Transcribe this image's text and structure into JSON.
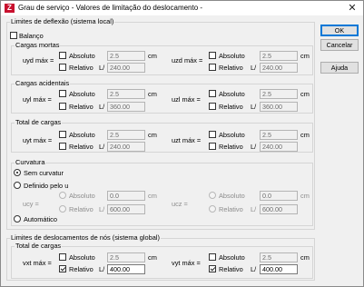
{
  "window": {
    "title": "Grau de serviço - Valores de limitação do deslocamento -",
    "close_glyph": "✕",
    "icon_glyph": "Z"
  },
  "buttons": {
    "ok": "OK",
    "cancel": "Cancelar",
    "help": "Ajuda"
  },
  "deflection": {
    "group_title": "Limites de deflexão (sistema local)",
    "balanco_label": "Balanço",
    "sections": [
      {
        "title": "Cargas mortas",
        "left": {
          "label": "uyd máx =",
          "absoluto_label": "Absoluto",
          "absoluto_value": "2.5",
          "unit": "cm",
          "relativo_label": "Relativo",
          "l_prefix": "L/",
          "relativo_value": "240.00"
        },
        "right": {
          "label": "uzd máx =",
          "absoluto_label": "Absoluto",
          "absoluto_value": "2.5",
          "unit": "cm",
          "relativo_label": "Relativo",
          "l_prefix": "L/",
          "relativo_value": "240.00"
        }
      },
      {
        "title": "Cargas acidentais",
        "left": {
          "label": "uyl máx =",
          "absoluto_label": "Absoluto",
          "absoluto_value": "2.5",
          "unit": "cm",
          "relativo_label": "Relativo",
          "l_prefix": "L/",
          "relativo_value": "360.00"
        },
        "right": {
          "label": "uzl máx =",
          "absoluto_label": "Absoluto",
          "absoluto_value": "2.5",
          "unit": "cm",
          "relativo_label": "Relativo",
          "l_prefix": "L/",
          "relativo_value": "360.00"
        }
      },
      {
        "title": "Total de cargas",
        "left": {
          "label": "uyt máx =",
          "absoluto_label": "Absoluto",
          "absoluto_value": "2.5",
          "unit": "cm",
          "relativo_label": "Relativo",
          "l_prefix": "L/",
          "relativo_value": "240.00"
        },
        "right": {
          "label": "uzt máx =",
          "absoluto_label": "Absoluto",
          "absoluto_value": "2.5",
          "unit": "cm",
          "relativo_label": "Relativo",
          "l_prefix": "L/",
          "relativo_value": "240.00"
        }
      }
    ],
    "curvatura": {
      "title": "Curvatura",
      "sem_curvatur": "Sem curvatur",
      "definido": "Definido pelo u",
      "automatico": "Automático",
      "left": {
        "label": "ucy =",
        "absoluto_label": "Absoluto",
        "absoluto_value": "0.0",
        "unit": "cm",
        "relativo_label": "Relativo",
        "l_prefix": "L/",
        "relativo_value": "600.00"
      },
      "right": {
        "label": "ucz =",
        "absoluto_label": "Absoluto",
        "absoluto_value": "0.0",
        "unit": "cm",
        "relativo_label": "Relativo",
        "l_prefix": "L/",
        "relativo_value": "600.00"
      }
    }
  },
  "nodes": {
    "group_title": "Limites de deslocamentos de nós (sistema global)",
    "section_title": "Total de cargas",
    "left": {
      "label": "vxt máx =",
      "absoluto_label": "Absoluto",
      "absoluto_value": "2.5",
      "unit": "cm",
      "relativo_label": "Relativo",
      "l_prefix": "L/",
      "relativo_value": "400.00"
    },
    "right": {
      "label": "vyt máx =",
      "absoluto_label": "Absoluto",
      "absoluto_value": "2.5",
      "unit": "cm",
      "relativo_label": "Relativo",
      "l_prefix": "L/",
      "relativo_value": "400.00"
    }
  }
}
